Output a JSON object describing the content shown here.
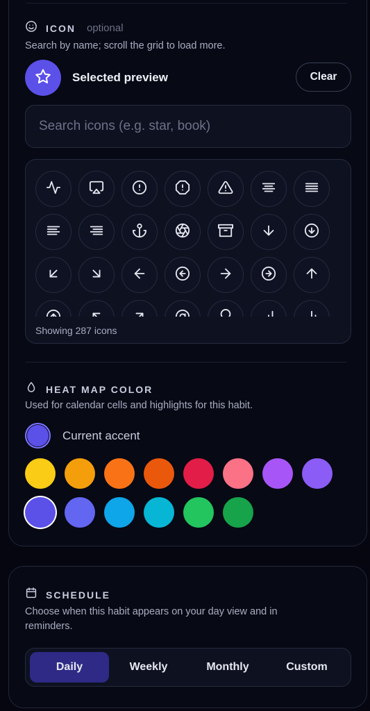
{
  "icon_section": {
    "title": "ICON",
    "hint": "optional",
    "description": "Search by name; scroll the grid to load more.",
    "section_icon": "smiley-icon",
    "preview": {
      "label": "Selected preview",
      "icon": "star-icon",
      "color": "#5b50e8"
    },
    "clear_label": "Clear",
    "search": {
      "placeholder": "Search icons (e.g. star, book)",
      "value": ""
    },
    "grid_icons": [
      "activity-icon",
      "airplay-icon",
      "alert-circle-icon",
      "alert-octagon-icon",
      "alert-triangle-icon",
      "align-center-icon",
      "align-justify-icon",
      "align-left-icon",
      "align-right-icon",
      "anchor-icon",
      "aperture-icon",
      "archive-icon",
      "arrow-down-icon",
      "arrow-down-circle-icon",
      "arrow-down-left-icon",
      "arrow-down-right-icon",
      "arrow-left-icon",
      "arrow-left-circle-icon",
      "arrow-right-icon",
      "arrow-right-circle-icon",
      "arrow-up-icon",
      "arrow-up-circle-icon",
      "arrow-up-left-icon",
      "arrow-up-right-icon",
      "at-sign-icon",
      "award-icon",
      "bar-chart-icon",
      "bar-chart-2-icon"
    ],
    "count_label": "Showing 287 icons"
  },
  "heatmap_section": {
    "title": "HEAT MAP COLOR",
    "section_icon": "droplet-icon",
    "description": "Used for calendar cells and highlights for this habit.",
    "current_label": "Current accent",
    "current_color": "#5b50e8",
    "swatches": [
      "#facc15",
      "#f59e0b",
      "#f97316",
      "#ea580c",
      "#e11d48",
      "#fb7185",
      "#a855f7",
      "#8b5cf6",
      "#5b50e8",
      "#6366f1",
      "#0ea5e9",
      "#06b6d4",
      "#22c55e",
      "#16a34a"
    ],
    "selected_swatch": 8
  },
  "schedule_section": {
    "title": "SCHEDULE",
    "section_icon": "calendar-icon",
    "description": "Choose when this habit appears on your day view and in reminders.",
    "options": [
      "Daily",
      "Weekly",
      "Monthly",
      "Custom"
    ],
    "active_option": 0
  }
}
